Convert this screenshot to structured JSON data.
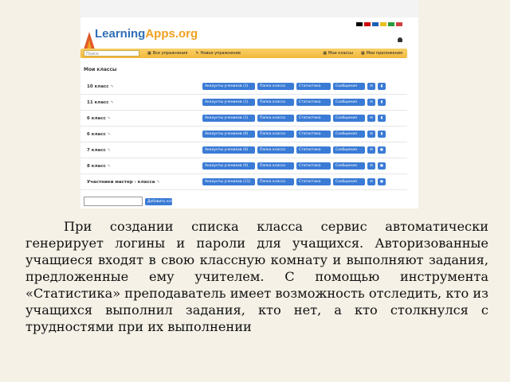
{
  "screenshot": {
    "brand": {
      "part1": "Learning",
      "part2": "Apps.org"
    },
    "search_placeholder": "Поиск",
    "nav": {
      "all_exercises": "Все упражнения",
      "new_exercise": "Новое упражнение",
      "my_classes": "Мои классы",
      "my_apps": "Мои приложения"
    },
    "heading": "Мои классы",
    "classes": [
      {
        "name": "10 класс",
        "students": "Аккаунты учеников (1)"
      },
      {
        "name": "11 класс",
        "students": "Аккаунты учеников (1)"
      },
      {
        "name": "6 класс",
        "students": "Аккаунты учеников (1)"
      },
      {
        "name": "6 класс",
        "students": "Аккаунты учеников (0)"
      },
      {
        "name": "7 класс",
        "students": "Аккаунты учеников (0)"
      },
      {
        "name": "8 класс",
        "students": "Аккаунты учеников (0)"
      },
      {
        "name": "Участники мастер - класса",
        "students": "Аккаунты учеников (11)"
      }
    ],
    "row_buttons": {
      "folder": "Папка класса",
      "stats": "Статистика",
      "messages": "Сообщения"
    },
    "add_button": "Добавить класс"
  },
  "paragraph": "При создании списка класса сервис автоматически генерирует логины и пароли для учащихся. Авторизованные учащиеся входят в свою классную комнату и выполняют задания, предложенные ему учителем. С помощью инструмента «Статистика» преподаватель имеет возможность отследить, кто из учащихся выполнил задания, кто нет, а кто столкнулся с трудностями при их выполнении",
  "colors": {
    "accent": "#3a7bd5",
    "nav": "#f2b83a",
    "background": "#f5f1e6"
  }
}
